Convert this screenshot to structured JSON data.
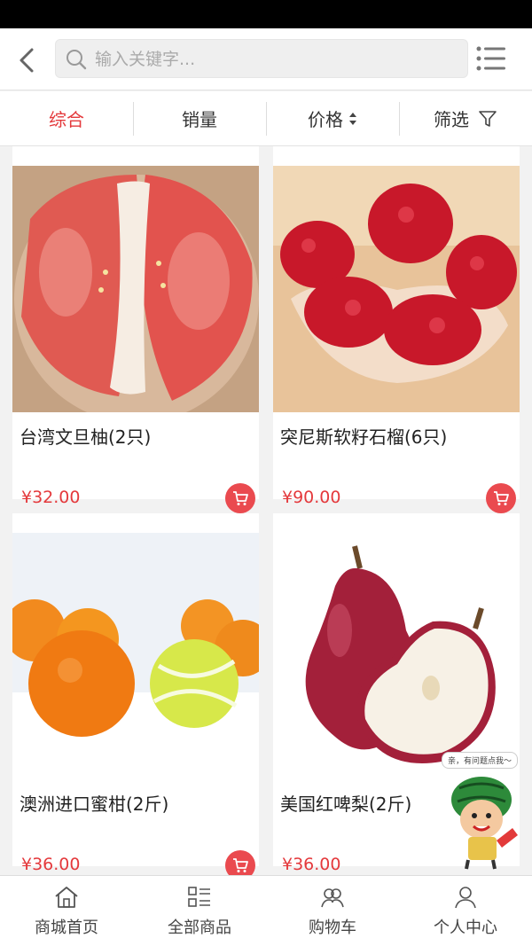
{
  "search": {
    "placeholder": "输入关键字..."
  },
  "sort": [
    {
      "label": "综合",
      "active": true
    },
    {
      "label": "销量"
    },
    {
      "label": "价格"
    },
    {
      "label": "筛选"
    }
  ],
  "products": [
    {
      "name": "台湾文旦柚(2只)",
      "price": "¥32.00"
    },
    {
      "name": "突尼斯软籽石榴(6只)",
      "price": "¥90.00"
    },
    {
      "name": "澳洲进口蜜柑(2斤)",
      "price": "¥36.00"
    },
    {
      "name": "美国红啤梨(2斤)",
      "price": "¥36.00"
    }
  ],
  "mascot": {
    "bubble": "亲，有问题点我～"
  },
  "tabbar": [
    {
      "label": "商城首页",
      "icon": "home-icon"
    },
    {
      "label": "全部商品",
      "icon": "grid-list-icon"
    },
    {
      "label": "购物车",
      "icon": "people-icon"
    },
    {
      "label": "个人中心",
      "icon": "person-icon"
    }
  ],
  "colors": {
    "accent": "#e4393c",
    "cart": "#ea4a4f"
  }
}
